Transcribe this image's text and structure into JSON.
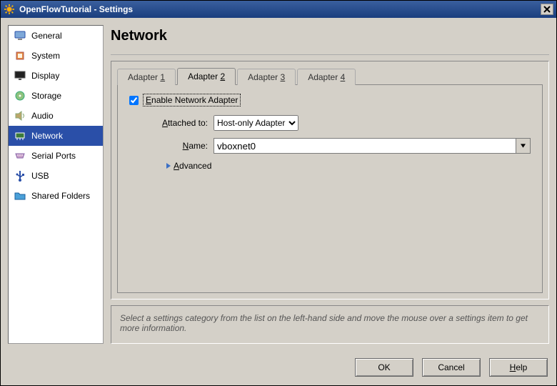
{
  "window": {
    "title": "OpenFlowTutorial - Settings"
  },
  "sidebar": {
    "items": [
      {
        "label": "General"
      },
      {
        "label": "System"
      },
      {
        "label": "Display"
      },
      {
        "label": "Storage"
      },
      {
        "label": "Audio"
      },
      {
        "label": "Network"
      },
      {
        "label": "Serial Ports"
      },
      {
        "label": "USB"
      },
      {
        "label": "Shared Folders"
      }
    ],
    "active_index": 5
  },
  "page": {
    "title": "Network"
  },
  "tabs": [
    {
      "prefix": "Adapter ",
      "accel": "1"
    },
    {
      "prefix": "Adapter ",
      "accel": "2"
    },
    {
      "prefix": "Adapter ",
      "accel": "3"
    },
    {
      "prefix": "Adapter ",
      "accel": "4"
    }
  ],
  "active_tab_index": 1,
  "form": {
    "enable_checked": true,
    "enable_label_pre": "E",
    "enable_label_post": "nable Network Adapter",
    "attached_label_pre": "A",
    "attached_label_post": "ttached to:",
    "attached_value": "Host-only Adapter",
    "name_label_pre": "N",
    "name_label_post": "ame:",
    "name_value": "vboxnet0",
    "advanced_label_pre": "A",
    "advanced_label_post": "dvanced"
  },
  "help_text": "Select a settings category from the list on the left-hand side and move the mouse over a settings item to get more information.",
  "buttons": {
    "ok": "OK",
    "cancel": "Cancel",
    "help_pre": "H",
    "help_post": "elp"
  }
}
